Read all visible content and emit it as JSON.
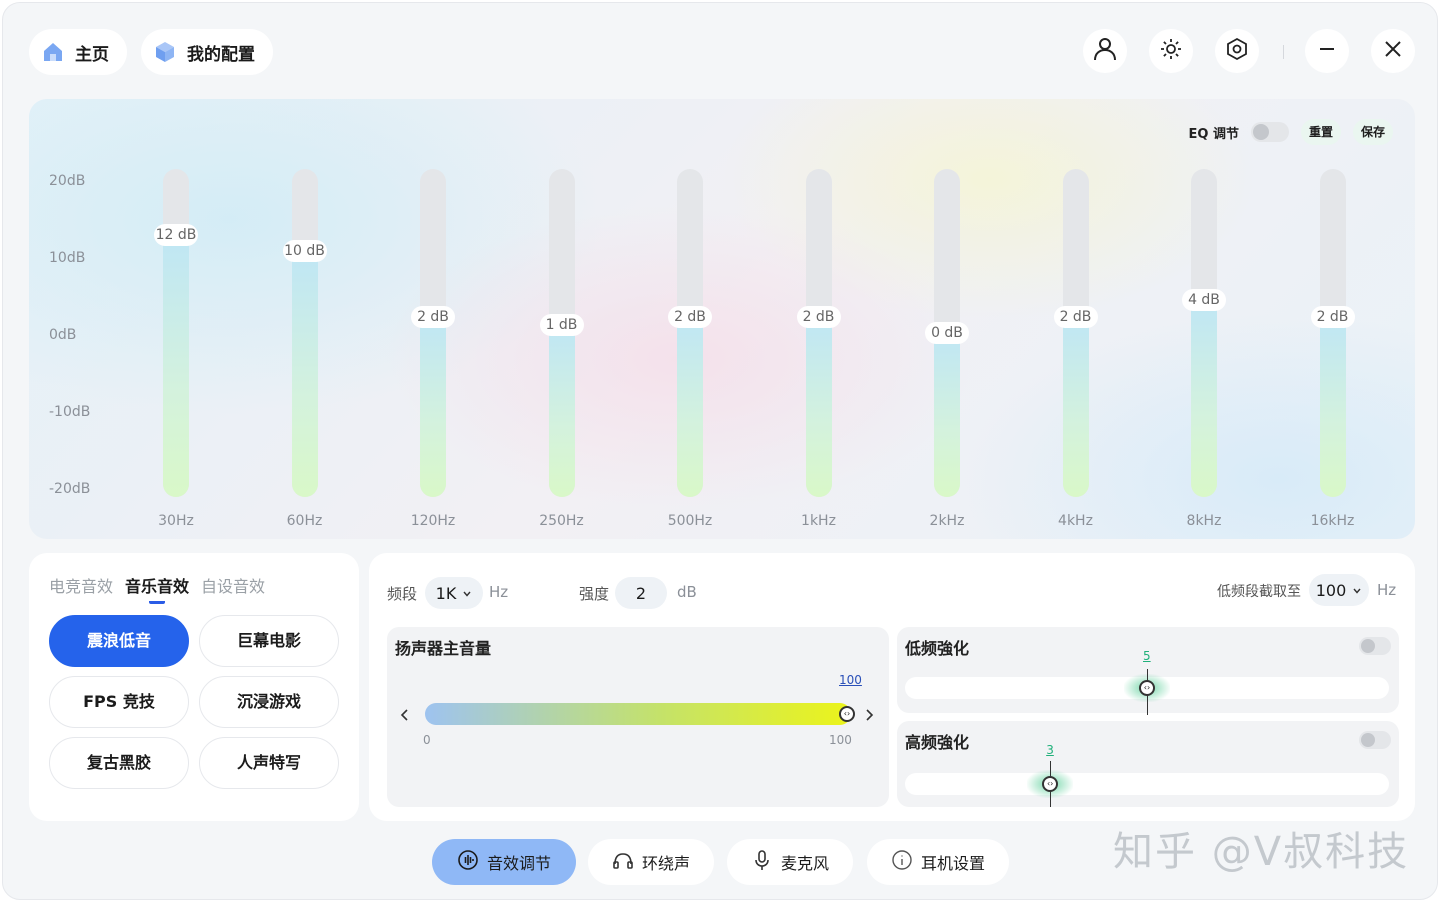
{
  "header": {
    "home_label": "主页",
    "config_label": "我的配置",
    "icons": [
      "user-icon",
      "brightness-icon",
      "hex-settings-icon",
      "minimize-icon",
      "close-icon"
    ]
  },
  "eq": {
    "toggle_label": "EQ 调节",
    "reset_label": "重置",
    "save_label": "保存",
    "enabled": false,
    "y_labels": [
      "20dB",
      "10dB",
      "0dB",
      "-10dB",
      "-20dB"
    ],
    "range": [
      -20,
      20
    ],
    "bands": [
      {
        "freq": "30Hz",
        "value": 12,
        "label": "12 dB"
      },
      {
        "freq": "60Hz",
        "value": 10,
        "label": "10 dB"
      },
      {
        "freq": "120Hz",
        "value": 2,
        "label": "2 dB"
      },
      {
        "freq": "250Hz",
        "value": 1,
        "label": "1 dB"
      },
      {
        "freq": "500Hz",
        "value": 2,
        "label": "2 dB"
      },
      {
        "freq": "1kHz",
        "value": 2,
        "label": "2 dB"
      },
      {
        "freq": "2kHz",
        "value": 0,
        "label": "0 dB"
      },
      {
        "freq": "4kHz",
        "value": 2,
        "label": "2 dB"
      },
      {
        "freq": "8kHz",
        "value": 4,
        "label": "4 dB"
      },
      {
        "freq": "16kHz",
        "value": 2,
        "label": "2 dB"
      }
    ]
  },
  "presets": {
    "tabs": [
      "电竞音效",
      "音乐音效",
      "自设音效"
    ],
    "active_tab": 1,
    "buttons": [
      "震浪低音",
      "巨幕电影",
      "FPS 竞技",
      "沉浸游戏",
      "复古黑胶",
      "人声特写"
    ],
    "active_button": 0
  },
  "controls": {
    "band_label": "频段",
    "band_value": "1K",
    "band_unit": "Hz",
    "strength_label": "强度",
    "strength_value": "2",
    "strength_unit": "dB",
    "cutoff_label": "低频段截取至",
    "cutoff_value": "100",
    "cutoff_unit": "Hz"
  },
  "speaker": {
    "title": "扬声器主音量",
    "value": "100",
    "min": "0",
    "max": "100",
    "level": 1.0
  },
  "bass": {
    "title": "低频強化",
    "value": "5",
    "level": 0.5,
    "enabled": false
  },
  "treble": {
    "title": "高频強化",
    "value": "3",
    "level": 0.3,
    "enabled": false
  },
  "nav": [
    {
      "label": "音效调节",
      "icon": "sound-wave-icon",
      "active": true
    },
    {
      "label": "环绕声",
      "icon": "headphones-icon",
      "active": false
    },
    {
      "label": "麦克风",
      "icon": "microphone-icon",
      "active": false
    },
    {
      "label": "耳机设置",
      "icon": "info-icon",
      "active": false
    }
  ],
  "watermark": "知乎 @V叔科技",
  "colors": {
    "accent": "#2563eb",
    "nav_active": "#8fb8f6",
    "value_green": "#20b07a"
  }
}
